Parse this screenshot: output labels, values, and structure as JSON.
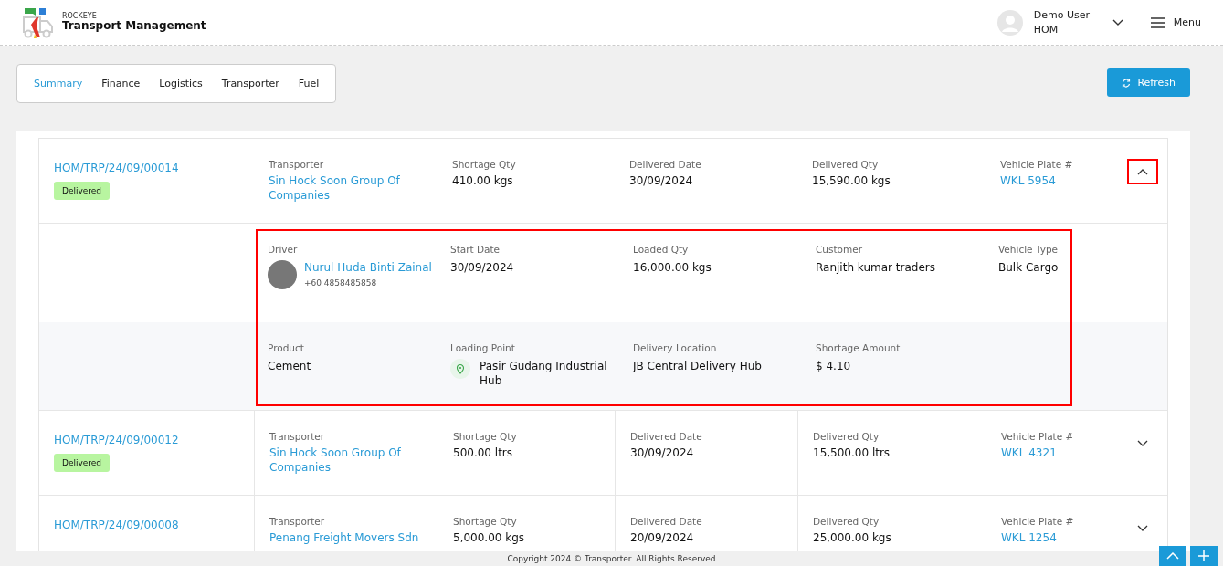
{
  "header": {
    "brand": "ROCKEYE",
    "title": "Transport Management",
    "user": {
      "name": "Demo User",
      "role": "HOM"
    },
    "menu_label": "Menu"
  },
  "tabs": [
    {
      "label": "Summary",
      "selected": true
    },
    {
      "label": "Finance",
      "selected": false
    },
    {
      "label": "Logistics",
      "selected": false
    },
    {
      "label": "Transporter",
      "selected": false
    },
    {
      "label": "Fuel",
      "selected": false
    }
  ],
  "refresh_label": "Refresh",
  "trips": [
    {
      "id": "HOM/TRP/24/09/00014",
      "status": "Delivered",
      "expanded": true,
      "highlighted": true,
      "fields": [
        {
          "label": "Transporter",
          "value": "Sin Hock Soon Group Of Companies",
          "kind": "link"
        },
        {
          "label": "Shortage Qty",
          "value": "410.00 kgs",
          "kind": "text"
        },
        {
          "label": "Delivered Date",
          "value": "30/09/2024",
          "kind": "text"
        },
        {
          "label": "Delivered Qty",
          "value": "15,590.00 kgs",
          "kind": "text"
        },
        {
          "label": "Vehicle Plate #",
          "value": "WKL 5954",
          "kind": "link"
        }
      ],
      "details": [
        [
          {
            "label": "Driver",
            "value": "Nurul Huda Binti Zainal",
            "phone": "+60 4858485858",
            "kind": "driver"
          },
          {
            "label": "Start Date",
            "value": "30/09/2024",
            "kind": "text"
          },
          {
            "label": "Loaded Qty",
            "value": "16,000.00 kgs",
            "kind": "text"
          },
          {
            "label": "Customer",
            "value": "Ranjith kumar traders",
            "kind": "text"
          },
          {
            "label": "Vehicle Type",
            "value": "Bulk Cargo",
            "kind": "text"
          }
        ],
        [
          {
            "label": "Product",
            "value": "Cement",
            "kind": "text"
          },
          {
            "label": "Loading Point",
            "value": "Pasir Gudang Industrial Hub",
            "kind": "location"
          },
          {
            "label": "Delivery Location",
            "value": "JB Central Delivery Hub",
            "kind": "text"
          },
          {
            "label": "Shortage Amount",
            "value": "$ 4.10",
            "kind": "text"
          }
        ]
      ]
    },
    {
      "id": "HOM/TRP/24/09/00012",
      "status": "Delivered",
      "expanded": false,
      "highlighted": false,
      "fields": [
        {
          "label": "Transporter",
          "value": "Sin Hock Soon Group Of Companies",
          "kind": "link"
        },
        {
          "label": "Shortage Qty",
          "value": "500.00 ltrs",
          "kind": "text"
        },
        {
          "label": "Delivered Date",
          "value": "30/09/2024",
          "kind": "text"
        },
        {
          "label": "Delivered Qty",
          "value": "15,500.00 ltrs",
          "kind": "text"
        },
        {
          "label": "Vehicle Plate #",
          "value": "WKL 4321",
          "kind": "link"
        }
      ]
    },
    {
      "id": "HOM/TRP/24/09/00008",
      "expanded": false,
      "highlighted": false,
      "fields": [
        {
          "label": "Transporter",
          "value": "Penang Freight Movers Sdn",
          "kind": "link"
        },
        {
          "label": "Shortage Qty",
          "value": "5,000.00 kgs",
          "kind": "text"
        },
        {
          "label": "Delivered Date",
          "value": "20/09/2024",
          "kind": "text"
        },
        {
          "label": "Delivered Qty",
          "value": "25,000.00 kgs",
          "kind": "text"
        },
        {
          "label": "Vehicle Plate #",
          "value": "WKL 1254",
          "kind": "link"
        }
      ]
    }
  ],
  "footer": "Copyright 2024 © Transporter. All Rights Reserved"
}
